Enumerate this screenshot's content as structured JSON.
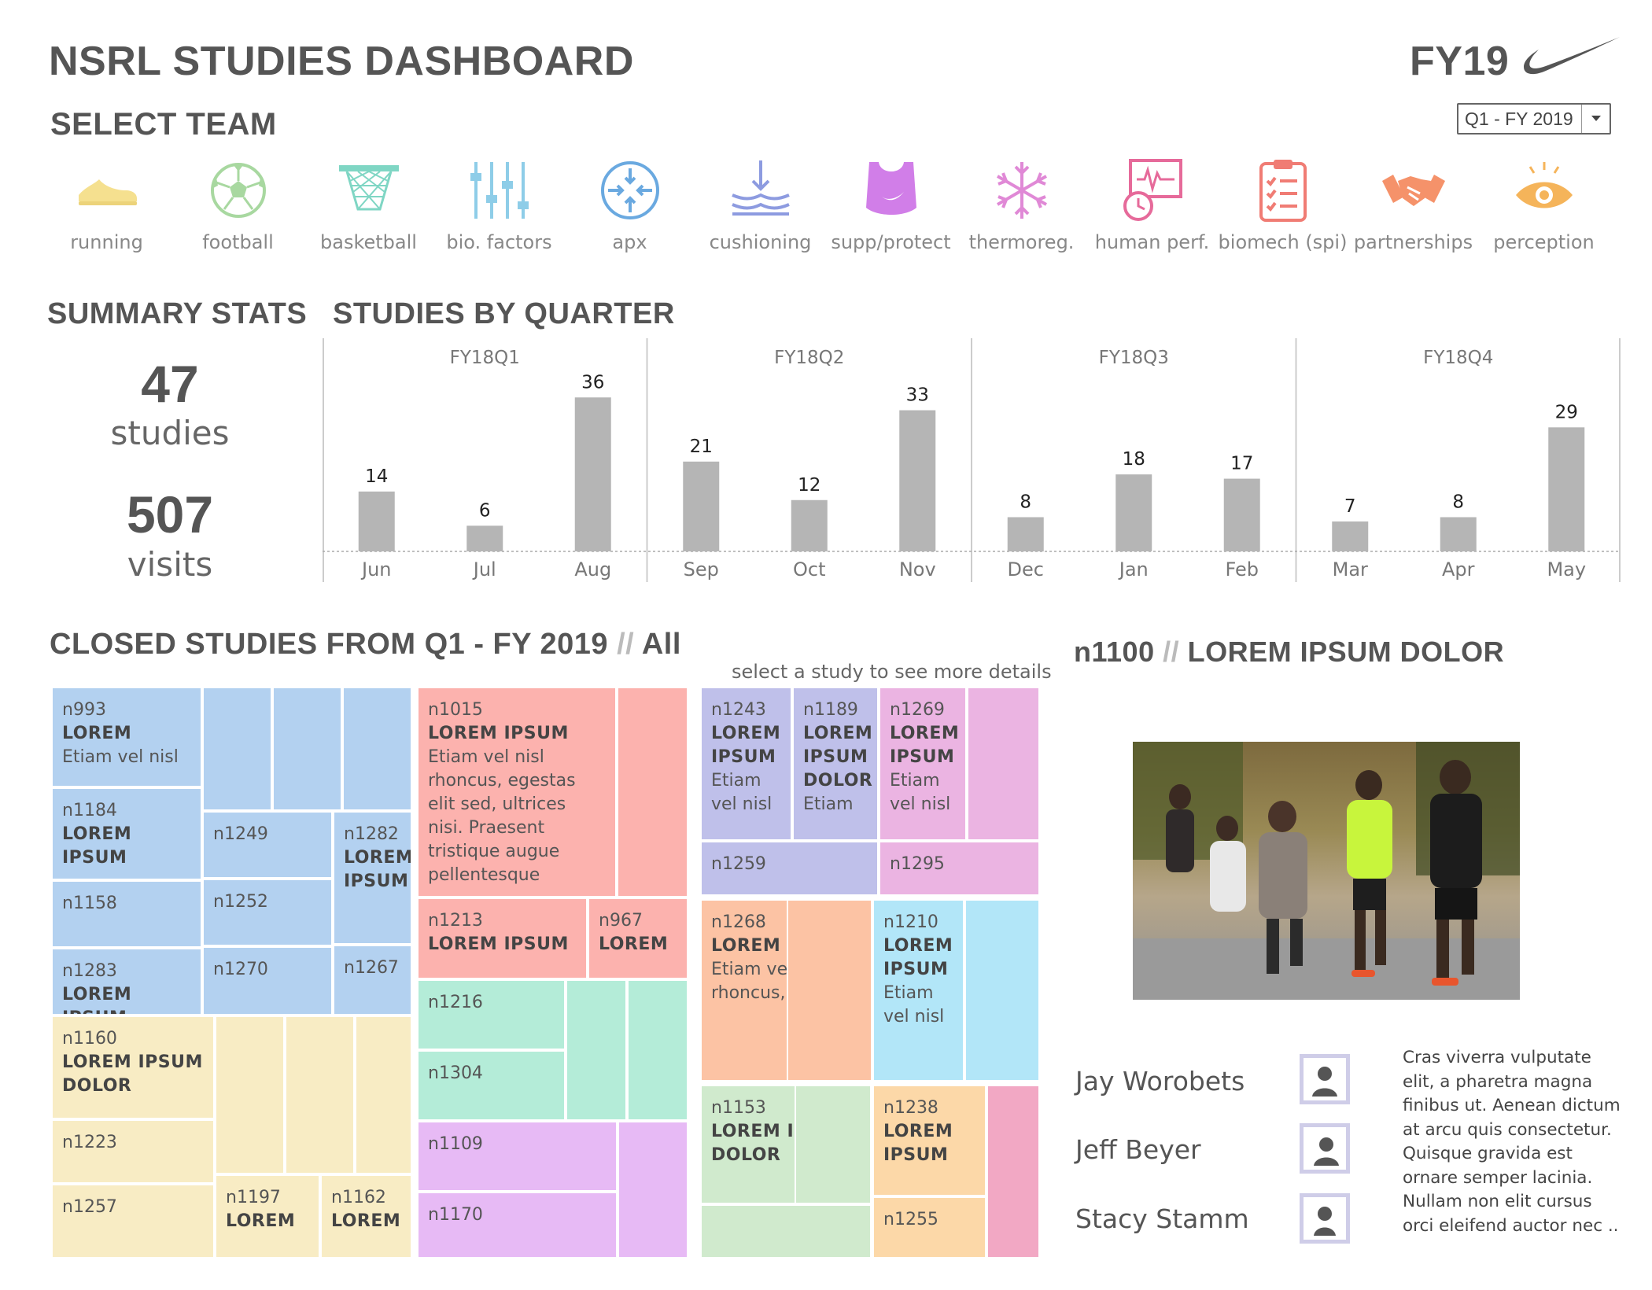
{
  "header": {
    "title": "NSRL STUDIES DASHBOARD",
    "fiscal_year": "FY19",
    "logo": "swoosh-logo"
  },
  "select_team": {
    "heading": "SELECT TEAM",
    "quarter_selected": "Q1 - FY 2019",
    "teams": [
      {
        "label": "running",
        "icon": "shoe-icon",
        "color": "#f5e08f"
      },
      {
        "label": "football",
        "icon": "soccer-ball-icon",
        "color": "#a8d8a0"
      },
      {
        "label": "basketball",
        "icon": "basketball-hoop-icon",
        "color": "#7fd6c4"
      },
      {
        "label": "bio. factors",
        "icon": "sliders-icon",
        "color": "#8ecde8"
      },
      {
        "label": "apx",
        "icon": "compass-arrows-icon",
        "color": "#6aa9e0"
      },
      {
        "label": "cushioning",
        "icon": "cushion-arrow-icon",
        "color": "#8d9be0"
      },
      {
        "label": "supp/protect",
        "icon": "sports-bra-icon",
        "color": "#d17ee8"
      },
      {
        "label": "thermoreg.",
        "icon": "snowflake-icon",
        "color": "#e089d6"
      },
      {
        "label": "human perf.",
        "icon": "performance-monitor-icon",
        "color": "#e66a9a"
      },
      {
        "label": "biomech (spi)",
        "icon": "clipboard-icon",
        "color": "#f07c74"
      },
      {
        "label": "partnerships",
        "icon": "handshake-icon",
        "color": "#f5926a"
      },
      {
        "label": "perception",
        "icon": "eye-icon",
        "color": "#f5b45a"
      }
    ]
  },
  "summary": {
    "heading": "SUMMARY STATS",
    "studies_value": "47",
    "studies_label": "studies",
    "visits_value": "507",
    "visits_label": "visits"
  },
  "chart_data": {
    "type": "bar",
    "title": "STUDIES BY QUARTER",
    "groups": [
      "FY18Q1",
      "FY18Q2",
      "FY18Q3",
      "FY18Q4"
    ],
    "categories": [
      "Jun",
      "Jul",
      "Aug",
      "Sep",
      "Oct",
      "Nov",
      "Dec",
      "Jan",
      "Feb",
      "Mar",
      "Apr",
      "May"
    ],
    "group_of_category": [
      0,
      0,
      0,
      1,
      1,
      1,
      2,
      2,
      2,
      3,
      3,
      3
    ],
    "values": [
      14,
      6,
      36,
      21,
      12,
      33,
      8,
      18,
      17,
      7,
      8,
      29
    ],
    "ylim": [
      0,
      48
    ],
    "bar_color": "#b5b5b5",
    "grid": false
  },
  "closed": {
    "heading_prefix": "CLOSED STUDIES FROM Q1 - FY 2019",
    "heading_sep": "//",
    "heading_filter": "All",
    "hint": "select a study to see more details",
    "cells": [
      {
        "id": "n993",
        "name": "LOREM",
        "desc": "Etiam vel nisl",
        "color": "#b3d1f0"
      },
      {
        "id": "",
        "name": "",
        "desc": "",
        "color": "#b3d1f0"
      },
      {
        "id": "",
        "name": "",
        "desc": "",
        "color": "#b3d1f0"
      },
      {
        "id": "",
        "name": "",
        "desc": "",
        "color": "#b3d1f0"
      },
      {
        "id": "n1184",
        "name": "LOREM IPSUM",
        "desc": "",
        "color": "#b3d1f0"
      },
      {
        "id": "n1249",
        "name": "",
        "desc": "",
        "color": "#b3d1f0"
      },
      {
        "id": "n1282",
        "name": "LOREM IPSUM",
        "desc": "",
        "color": "#b3d1f0"
      },
      {
        "id": "n1158",
        "name": "",
        "desc": "",
        "color": "#b3d1f0"
      },
      {
        "id": "n1252",
        "name": "",
        "desc": "",
        "color": "#b3d1f0"
      },
      {
        "id": "n1283",
        "name": "LOREM IPSUM",
        "desc": "",
        "color": "#b3d1f0"
      },
      {
        "id": "n1270",
        "name": "",
        "desc": "",
        "color": "#b3d1f0"
      },
      {
        "id": "n1267",
        "name": "",
        "desc": "",
        "color": "#b3d1f0"
      },
      {
        "id": "n1160",
        "name": "LOREM IPSUM DOLOR",
        "desc": "",
        "color": "#f8ecc4"
      },
      {
        "id": "",
        "name": "",
        "desc": "",
        "color": "#f8ecc4"
      },
      {
        "id": "",
        "name": "",
        "desc": "",
        "color": "#f8ecc4"
      },
      {
        "id": "",
        "name": "",
        "desc": "",
        "color": "#f8ecc4"
      },
      {
        "id": "n1223",
        "name": "",
        "desc": "",
        "color": "#f8ecc4"
      },
      {
        "id": "n1257",
        "name": "",
        "desc": "",
        "color": "#f8ecc4"
      },
      {
        "id": "n1197",
        "name": "LOREM",
        "desc": "",
        "color": "#f8ecc4"
      },
      {
        "id": "n1162",
        "name": "LOREM",
        "desc": "",
        "color": "#f8ecc4"
      },
      {
        "id": "n1015",
        "name": "LOREM IPSUM",
        "desc": "Etiam vel nisl rhoncus, egestas elit sed, ultrices nisi. Praesent tristique augue pellentesque",
        "color": "#fcb2ae"
      },
      {
        "id": "",
        "name": "",
        "desc": "",
        "color": "#fcb2ae"
      },
      {
        "id": "n1213",
        "name": "LOREM IPSUM",
        "desc": "",
        "color": "#fcb2ae"
      },
      {
        "id": "n967",
        "name": "LOREM",
        "desc": "",
        "color": "#fcb2ae"
      },
      {
        "id": "n1216",
        "name": "",
        "desc": "",
        "color": "#b4ecd8"
      },
      {
        "id": "",
        "name": "",
        "desc": "",
        "color": "#b4ecd8"
      },
      {
        "id": "",
        "name": "",
        "desc": "",
        "color": "#b4ecd8"
      },
      {
        "id": "n1304",
        "name": "",
        "desc": "",
        "color": "#b4ecd8"
      },
      {
        "id": "n1109",
        "name": "",
        "desc": "",
        "color": "#e7baf5"
      },
      {
        "id": "",
        "name": "",
        "desc": "",
        "color": "#e7baf5"
      },
      {
        "id": "n1170",
        "name": "",
        "desc": "",
        "color": "#e7baf5"
      },
      {
        "id": "n1243",
        "name": "LOREM IPSUM",
        "desc": "Etiam vel nisl",
        "color": "#bfc0ea"
      },
      {
        "id": "n1189",
        "name": "LOREM IPSUM DOLOR",
        "desc": "Etiam",
        "color": "#bfc0ea"
      },
      {
        "id": "n1259",
        "name": "",
        "desc": "",
        "color": "#bfc0ea"
      },
      {
        "id": "n1269",
        "name": "LOREM IPSUM",
        "desc": "Etiam vel nisl",
        "color": "#ebb4e2"
      },
      {
        "id": "",
        "name": "",
        "desc": "",
        "color": "#ebb4e2"
      },
      {
        "id": "n1295",
        "name": "",
        "desc": "",
        "color": "#ebb4e2"
      },
      {
        "id": "n1268",
        "name": "LOREM IPSUM",
        "desc": "Etiam vel nisl rhoncus,",
        "color": "#fcc3a4"
      },
      {
        "id": "",
        "name": "",
        "desc": "",
        "color": "#fcc3a4"
      },
      {
        "id": "n1210",
        "name": "LOREM IPSUM",
        "desc": "Etiam vel nisl",
        "color": "#b2e6f8"
      },
      {
        "id": "",
        "name": "",
        "desc": "",
        "color": "#b2e6f8"
      },
      {
        "id": "n1153",
        "name": "LOREM IPSUM DOLOR",
        "desc": "",
        "color": "#d0eacd"
      },
      {
        "id": "",
        "name": "",
        "desc": "",
        "color": "#d0eacd"
      },
      {
        "id": "",
        "name": "",
        "desc": "",
        "color": "#d0eacd"
      },
      {
        "id": "n1238",
        "name": "LOREM IPSUM",
        "desc": "",
        "color": "#fcd8a8"
      },
      {
        "id": "n1255",
        "name": "",
        "desc": "",
        "color": "#fcd8a8"
      },
      {
        "id": "",
        "name": "",
        "desc": "",
        "color": "#f2a8c4"
      }
    ]
  },
  "detail": {
    "study_id": "n1100",
    "sep": "//",
    "study_name": "LOREM IPSUM DOLOR",
    "people": [
      {
        "name": "Jay Worobets",
        "avatar": "person-avatar-icon"
      },
      {
        "name": "Jeff Beyer",
        "avatar": "person-avatar-icon"
      },
      {
        "name": "Stacy Stamm",
        "avatar": "person-avatar-icon"
      }
    ],
    "description": "Cras viverra vulputate elit, a pharetra magna finibus ut. Aenean dictum at arcu quis consectetur. Quisque gravida est ornare semper lacinia. Nullam non elit cursus orci eleifend auctor nec .."
  }
}
